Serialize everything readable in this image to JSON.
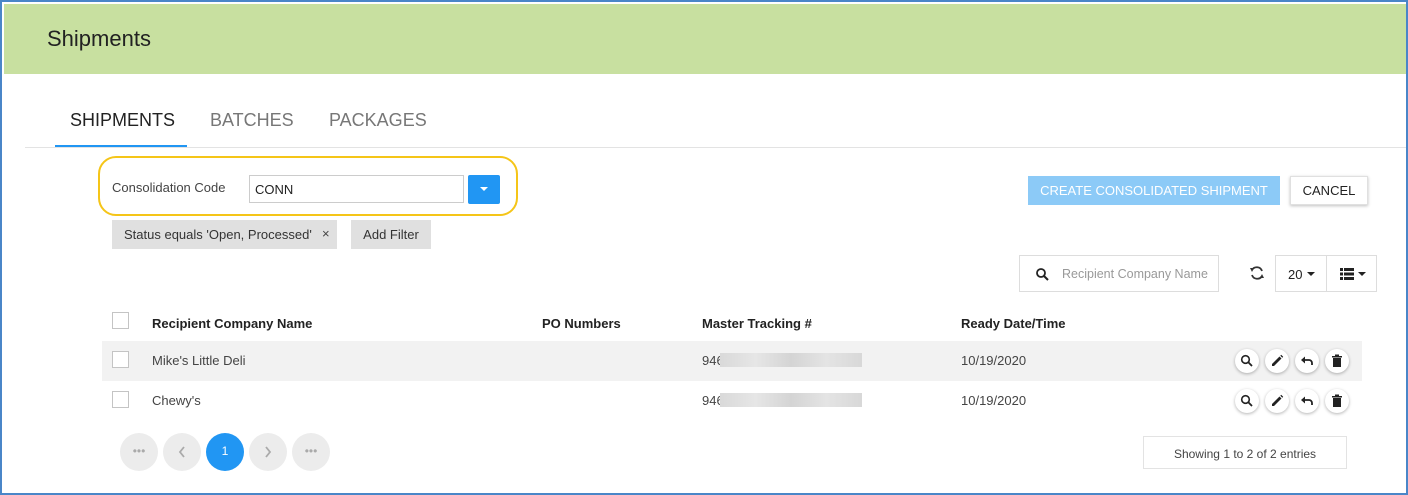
{
  "header": {
    "title": "Shipments"
  },
  "tabs": [
    {
      "label": "SHIPMENTS",
      "active": true
    },
    {
      "label": "BATCHES",
      "active": false
    },
    {
      "label": "PACKAGES",
      "active": false
    }
  ],
  "consolidation": {
    "label": "Consolidation Code",
    "value": "CONN"
  },
  "filters": {
    "chip": "Status equals 'Open, Processed'",
    "remove": "×",
    "add_label": "Add Filter"
  },
  "actions": {
    "create_label": "CREATE CONSOLIDATED SHIPMENT",
    "cancel_label": "CANCEL"
  },
  "toolbar": {
    "search_placeholder": "Recipient Company Name",
    "page_size": "20"
  },
  "table": {
    "columns": [
      "Recipient Company Name",
      "PO Numbers",
      "Master Tracking #",
      "Ready Date/Time"
    ],
    "rows": [
      {
        "company": "Mike's Little Deli",
        "po": "",
        "tracking": "946",
        "ready": "10/19/2020"
      },
      {
        "company": "Chewy's",
        "po": "",
        "tracking": "946",
        "ready": "10/19/2020"
      }
    ]
  },
  "pagination": {
    "first": "•••",
    "current": "1",
    "last": "•••",
    "showing": "Showing 1 to 2 of 2 entries"
  },
  "colors": {
    "header_bg": "#c8e0a0",
    "accent": "#2196f3",
    "highlight": "#f5c518"
  }
}
